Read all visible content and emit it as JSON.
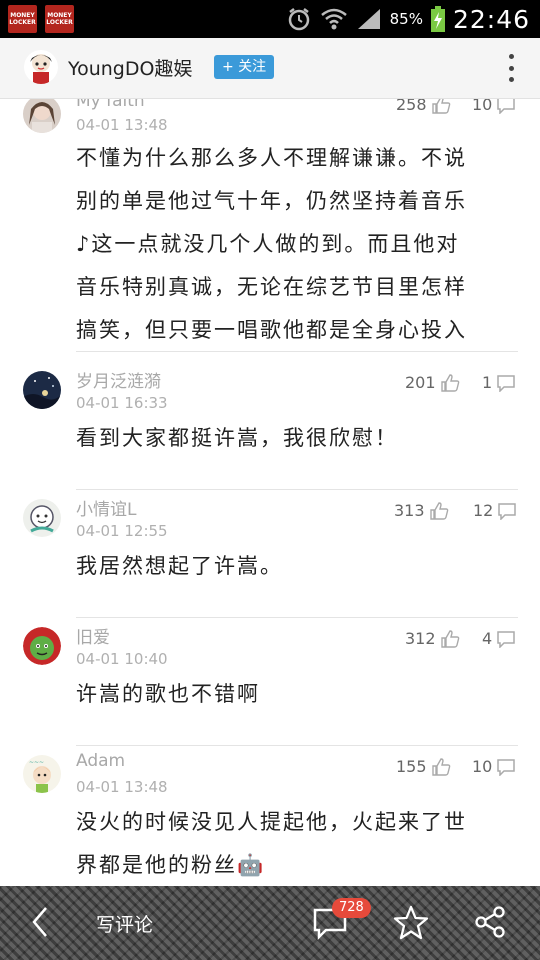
{
  "status_bar": {
    "app_badges": [
      "MONEY LOCKER",
      "MONEY LOCKER"
    ],
    "battery": "85%",
    "time": "22:46"
  },
  "header": {
    "name": "YoungDO趣娱",
    "follow_label": "+ 关注"
  },
  "comments": [
    {
      "name": "My faith",
      "time": "04-01 13:48",
      "likes": "258",
      "replies": "10",
      "lines": [
        "不懂为什么那么多人不理解谦谦。不说",
        "别的单是他过气十年，仍然坚持着音乐",
        "♪这一点就没几个人做的到。而且他对",
        "音乐特别真诚，无论在综艺节目里怎样",
        "搞笑，但只要一唱歌他都是全身心投入"
      ]
    },
    {
      "name": "岁月泛涟漪",
      "time": "04-01 16:33",
      "likes": "201",
      "replies": "1",
      "lines": [
        "看到大家都挺许嵩，我很欣慰！"
      ]
    },
    {
      "name": "小情谊L",
      "time": "04-01 12:55",
      "likes": "313",
      "replies": "12",
      "lines": [
        "我居然想起了许嵩。"
      ]
    },
    {
      "name": "旧爱",
      "time": "04-01 10:40",
      "likes": "312",
      "replies": "4",
      "lines": [
        "许嵩的歌也不错啊"
      ]
    },
    {
      "name": "Adam",
      "time": "04-01 13:48",
      "likes": "155",
      "replies": "10",
      "lines": [
        "没火的时候没见人提起他，火起来了世",
        "界都是他的粉丝🤖"
      ]
    }
  ],
  "bottom_bar": {
    "write_comment": "写评论",
    "comment_count": "728"
  },
  "colors": {
    "accent": "#3b9ad9",
    "badge": "#e64a3b"
  }
}
